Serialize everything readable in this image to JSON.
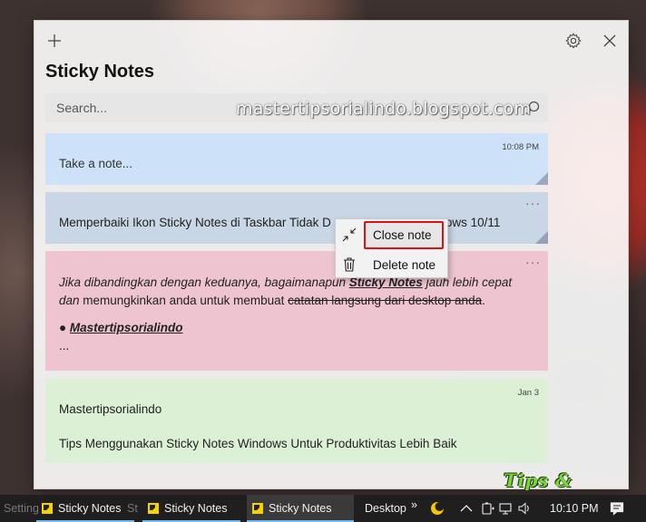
{
  "app": {
    "title": "Sticky Notes",
    "new_note_icon": "plus-icon",
    "settings_icon": "gear-icon",
    "close_icon": "close-icon"
  },
  "search": {
    "placeholder": "Search...",
    "icon": "search-icon"
  },
  "watermark": "mastertipsorialindo.blogspot.com",
  "notes": [
    {
      "color": "#c8e0fa",
      "time": "10:08 PM",
      "text": "Take a note..."
    },
    {
      "color": "#c4d4e4",
      "text": "Memperbaiki Ikon Sticky Notes di Taskbar Tidak D",
      "text_tail": "ows 10/11",
      "more": "···"
    },
    {
      "color": "#eebecc",
      "more": "···",
      "line1_a": "Jika dibandingkan dengan keduanya, bagaimanapun ",
      "line1_b": "Sticky Notes",
      "line1_c": " jauh lebih cepat",
      "line2_a": "dan ",
      "line2_b": "memungkinkan anda untuk membuat ",
      "line2_c": "catatan langsung dari desktop anda",
      "line2_d": ".",
      "bullet": "●",
      "bullet_text": "Mastertipsorialindo",
      "ellipsis": "..."
    },
    {
      "color": "#daf0d2",
      "time": "Jan 3",
      "line1": "Mastertipsorialindo",
      "line2": "Tips Menggunakan Sticky Notes Windows Untuk Produktivitas Lebih Baik"
    }
  ],
  "context_menu": {
    "items": [
      {
        "label": "Close note",
        "icon": "collapse-icon",
        "highlighted": true
      },
      {
        "label": "Delete note",
        "icon": "trash-icon"
      }
    ]
  },
  "taskbar": {
    "ghost_left": "Setting",
    "ghost_mid": "St",
    "buttons": [
      {
        "label": "Sticky Notes"
      },
      {
        "label": "Sticky Notes"
      },
      {
        "label": "Sticky Notes",
        "active": true
      }
    ],
    "desktop_label": "Desktop",
    "chevron": "»",
    "clock": "10:10 PM"
  },
  "overlay_badge": "Tips & Tutorial"
}
